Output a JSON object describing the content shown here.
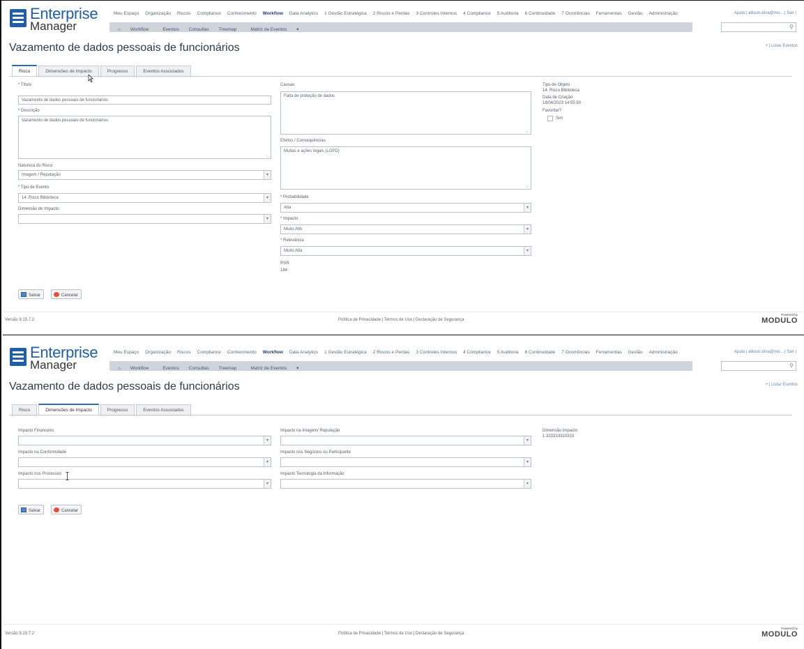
{
  "app": {
    "logo_line1": "Enterprise",
    "logo_line2": "Manager",
    "top_nav": [
      "Meu Espaço",
      "Organização",
      "Riscos",
      "Compliance",
      "Conhecimento",
      "Workflow",
      "Data Analytics",
      "1 Gestão Estratégica",
      "2 Riscos e Perdas",
      "3 Controles Internos",
      "4 Compliance",
      "5 Auditoria",
      "6 Continuidade",
      "7 Ocorrências",
      "Ferramentas",
      "Gestão",
      "Administração"
    ],
    "top_nav_active": "Workflow",
    "user": "Ajuda | allison.silva@mo... | Sair |",
    "sub_nav": [
      "Workflow",
      "Eventos",
      "Consultas",
      "Treemap",
      "Matriz de Eventos"
    ],
    "page_title": "Vazamento de dados pessoais de funcionários",
    "list_link": "+ | Listar Eventos",
    "tabs": [
      "Risco",
      "Dimensões de Impacto",
      "Progresso",
      "Eventos Associados"
    ],
    "footer": {
      "version": "Versão 9.15.7.2",
      "links": "Política de Privacidade | Termos de Uso | Declaração de Segurança",
      "powered": "Powered by",
      "brand": "MODULO"
    },
    "accent": "#1f5ea8"
  },
  "screen1": {
    "left": {
      "titulo_label": "* Título",
      "titulo_value": "Vazamento de dados pessoais de funcionários",
      "descricao_label": "* Descrição",
      "descricao_value": "Vazamento de dados pessoais de funcionários",
      "natureza_label": "Natureza do Risco",
      "natureza_value": "Imagem / Reputação",
      "tipo_evento_label": "* Tipo de Evento",
      "tipo_evento_value": "14. Risco Biblioteca",
      "dimensao_label": "Dimensão de Impacto",
      "dimensao_value": ""
    },
    "middle": {
      "causas_label": "Causas",
      "causas_value": "Falta de proteção de dados",
      "efeitos_label": "Efeitos / Consequências",
      "efeitos_value": "Multas e ações legais (LGPD)",
      "probabilidade_label": "* Probabilidade",
      "probabilidade_value": "Alta",
      "impacto_label": "* Impacto",
      "impacto_value": "Muito Alto",
      "relevancia_label": "* Relevância",
      "relevancia_value": "Muito Alta",
      "rsr_label": "RSR",
      "rsr_value": "184"
    },
    "right": {
      "tipo_objeto_label": "Tipo de Objeto",
      "tipo_objeto_value": "14. Risco Biblioteca",
      "data_criacao_label": "Data de Criação",
      "data_criacao_value": "18/04/2023 14:55:50",
      "favoritar_label": "Favoritar?",
      "favoritar_option": "Sim"
    },
    "buttons": {
      "save": "Salvar",
      "cancel": "Cancelar"
    }
  },
  "screen2": {
    "left": {
      "fin_label": "Impacto Financeiro",
      "conf_label": "Impacto na Conformidade",
      "proc_label": "Impacto nos Processos"
    },
    "middle": {
      "img_label": "Impacto na Imagem/ Reputação",
      "neg_label": "Impacto nos Negócios ou Participante",
      "ti_label": "Impacto Tecnologia da Informação"
    },
    "right": {
      "dim_label": "Dimensão Impacto",
      "dim_value": "1.333333333333"
    },
    "buttons": {
      "save": "Salvar",
      "cancel": "Cancelar"
    }
  }
}
